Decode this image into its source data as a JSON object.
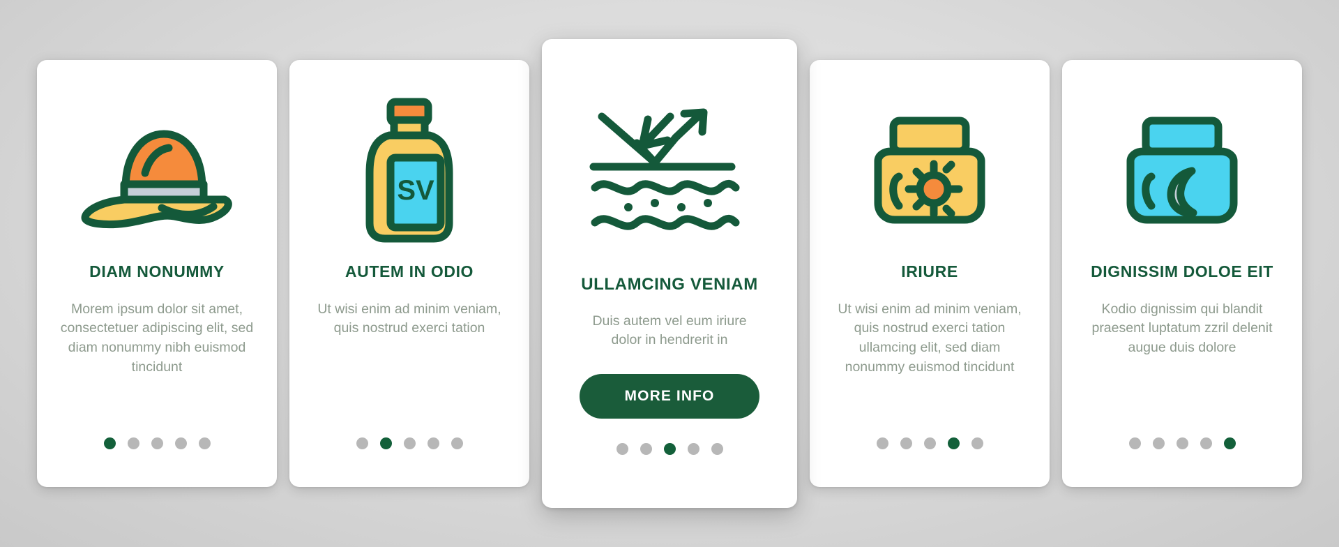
{
  "theme": {
    "dark_green": "#14593a",
    "button_green": "#1a5c3a",
    "body_text_gray": "#8d9a8d",
    "dot_inactive": "#b7b7b7",
    "dot_active": "#13603a",
    "card_bg": "#ffffff",
    "page_bg": "#dcdcdc",
    "icon_yellow": "#f9cd62",
    "icon_orange": "#f58b3c",
    "icon_cyan": "#4ad3ef",
    "icon_light_gray": "#c5cfd8"
  },
  "cards": [
    {
      "id": "card-1",
      "icon_name": "sun-hat-icon",
      "title": "DIAM NONUMMY",
      "body": "Morem ipsum dolor sit amet, consectetuer adipiscing elit, sed diam nonummy nibh euismod tincidunt",
      "dots_total": 5,
      "dot_active_index": 1,
      "featured": false,
      "button_label": null
    },
    {
      "id": "card-2",
      "icon_name": "sunscreen-bottle-icon",
      "icon_label": "SV",
      "title": "AUTEM IN ODIO",
      "body": "Ut wisi enim ad minim veniam, quis nostrud exerci tation",
      "dots_total": 5,
      "dot_active_index": 2,
      "featured": false,
      "button_label": null
    },
    {
      "id": "card-3",
      "icon_name": "uv-rays-skin-protection-icon",
      "title": "ULLAMCING VENIAM",
      "body": "Duis autem vel eum iriure dolor in hendrerit in",
      "dots_total": 5,
      "dot_active_index": 3,
      "featured": true,
      "button_label": "MORE INFO"
    },
    {
      "id": "card-4",
      "icon_name": "day-cream-jar-sun-icon",
      "title": "IRIURE",
      "body": "Ut wisi enim ad minim veniam, quis nostrud exerci tation ullamcing elit, sed diam nonummy euismod tincidunt",
      "dots_total": 5,
      "dot_active_index": 4,
      "featured": false,
      "button_label": null
    },
    {
      "id": "card-5",
      "icon_name": "night-cream-jar-moon-icon",
      "title": "DIGNISSIM DOLOE EIT",
      "body": "Kodio dignissim qui blandit praesent luptatum zzril delenit augue duis dolore",
      "dots_total": 5,
      "dot_active_index": 5,
      "featured": false,
      "button_label": null
    }
  ]
}
